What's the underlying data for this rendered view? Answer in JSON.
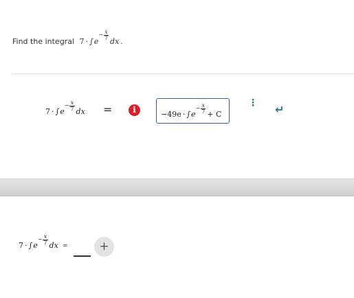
{
  "prompt": {
    "label": "Find the integral",
    "coef": "7",
    "dot": "·",
    "int": "∫",
    "base": "e",
    "exp_sign": "−",
    "exp_num": "x",
    "exp_den": "7",
    "dx": "dx",
    "period": "."
  },
  "row1": {
    "lhs": {
      "coef": "7",
      "dot": "·",
      "int": "∫",
      "base": "e",
      "exp_sign": "−",
      "exp_num": "x",
      "exp_den": "7",
      "dx": "dx"
    },
    "eq": "=",
    "info_icon": "i",
    "answer": {
      "coef": "−49e",
      "dot": "·",
      "int": "∫",
      "base": "e",
      "exp_sign": "−",
      "exp_num": "x",
      "exp_den": "7",
      "plus_c": "+ C"
    },
    "menu_icon": "⋮",
    "enter_icon": "↵"
  },
  "row2": {
    "lhs": {
      "coef": "7",
      "dot": "·",
      "int": "∫",
      "base": "e",
      "exp_sign": "−",
      "exp_num": "x",
      "exp_den": "7",
      "dx": "dx"
    },
    "eq": "=",
    "add_icon": "+"
  }
}
